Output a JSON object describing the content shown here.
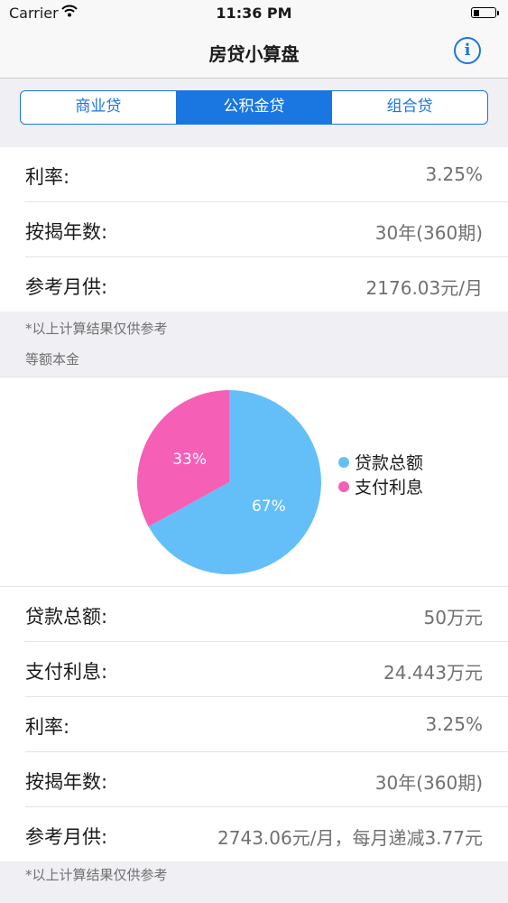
{
  "status_bar": {
    "carrier": "Carrier",
    "time": "11:36 PM"
  },
  "nav": {
    "title": "房贷小算盘",
    "info_icon_glyph": "i"
  },
  "segments": [
    {
      "label": "商业贷",
      "active": false
    },
    {
      "label": "公积金贷",
      "active": true
    },
    {
      "label": "组合贷",
      "active": false
    }
  ],
  "section1": {
    "rows": [
      {
        "label": "利率:",
        "value": "3.25%"
      },
      {
        "label": "按揭年数:",
        "value": "30年(360期)"
      },
      {
        "label": "参考月供:",
        "value": "2176.03元/月"
      }
    ],
    "note": "*以上计算结果仅供参考",
    "next_header": "等额本金"
  },
  "chart_data": {
    "type": "pie",
    "categories": [
      "贷款总额",
      "支付利息"
    ],
    "values": [
      67,
      33
    ],
    "value_labels": [
      "67%",
      "33%"
    ],
    "colors": [
      "#64bff8",
      "#f55fb6"
    ],
    "legend_position": "right"
  },
  "section2": {
    "rows": [
      {
        "label": "贷款总额:",
        "value": "50万元"
      },
      {
        "label": "支付利息:",
        "value": "24.443万元"
      },
      {
        "label": "利率:",
        "value": "3.25%"
      },
      {
        "label": "按揭年数:",
        "value": "30年(360期)"
      },
      {
        "label": "参考月供:",
        "value": "2743.06元/月，每月递减3.77元"
      }
    ],
    "note": "*以上计算结果仅供参考"
  }
}
